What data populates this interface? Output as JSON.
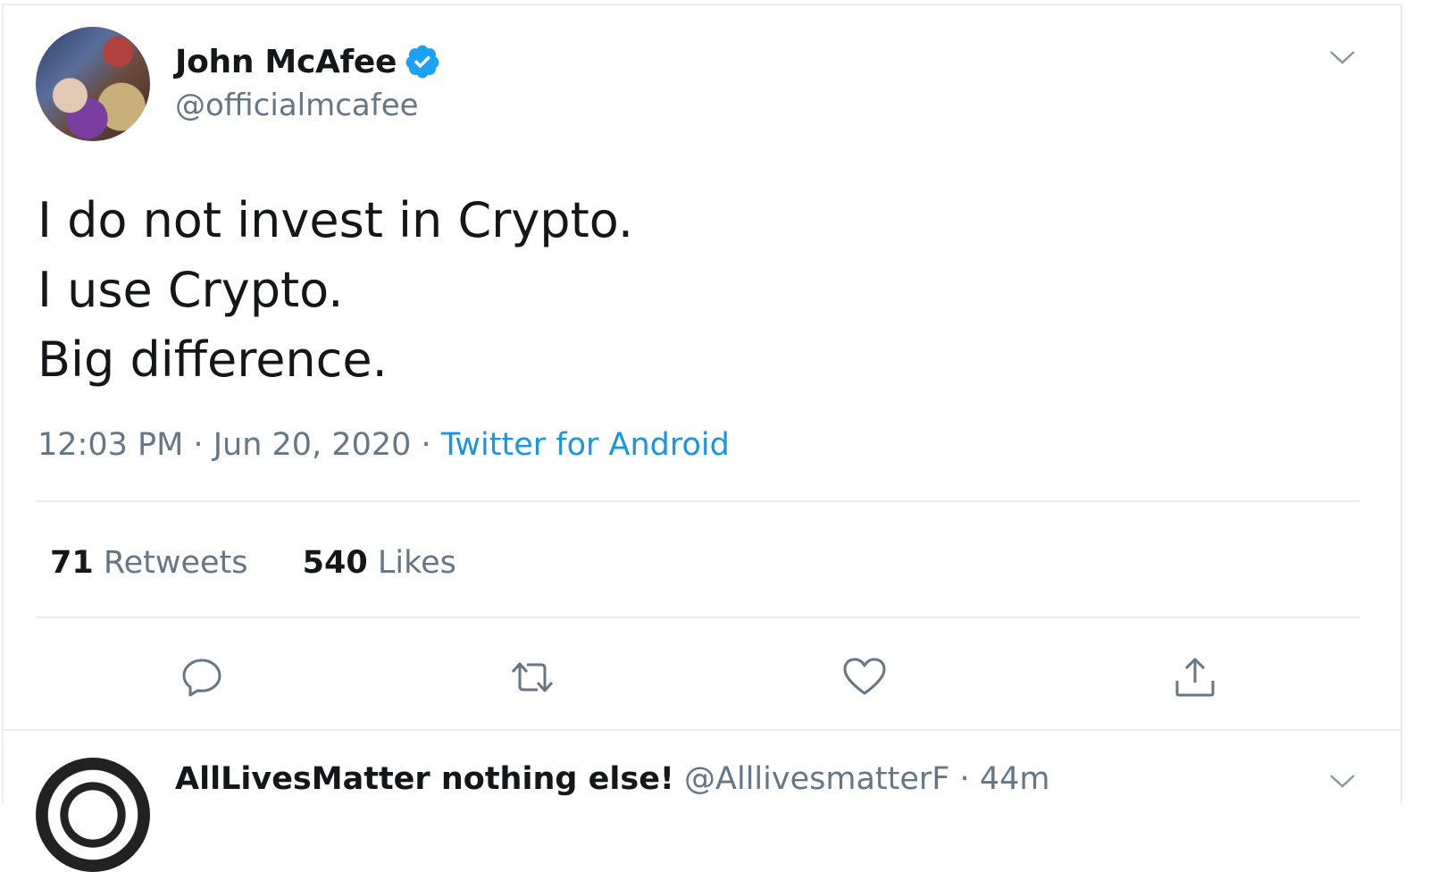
{
  "tweet": {
    "display_name": "John McAfee",
    "handle": "@officialmcafee",
    "text_lines": [
      "I do not invest in Crypto.",
      "I use Crypto.",
      "Big difference."
    ],
    "time": "12:03 PM",
    "date": "Jun 20, 2020",
    "separator": "·",
    "source": "Twitter for Android",
    "retweets_count": "71",
    "retweets_label": "Retweets",
    "likes_count": "540",
    "likes_label": "Likes"
  },
  "reply": {
    "display_name": "AllLivesMatter nothing else!",
    "handle": "@AlllivesmatterF",
    "separator": "·",
    "age": "44m"
  },
  "icons": {
    "verified": "verified-badge-icon",
    "caret": "chevron-down-icon",
    "reply": "reply-icon",
    "retweet": "retweet-icon",
    "like": "heart-icon",
    "share": "share-icon"
  },
  "colors": {
    "text": "#14171a",
    "secondary": "#657786",
    "link": "#1b95e0",
    "verified": "#1da1f2",
    "divider": "#e6ecf0"
  }
}
